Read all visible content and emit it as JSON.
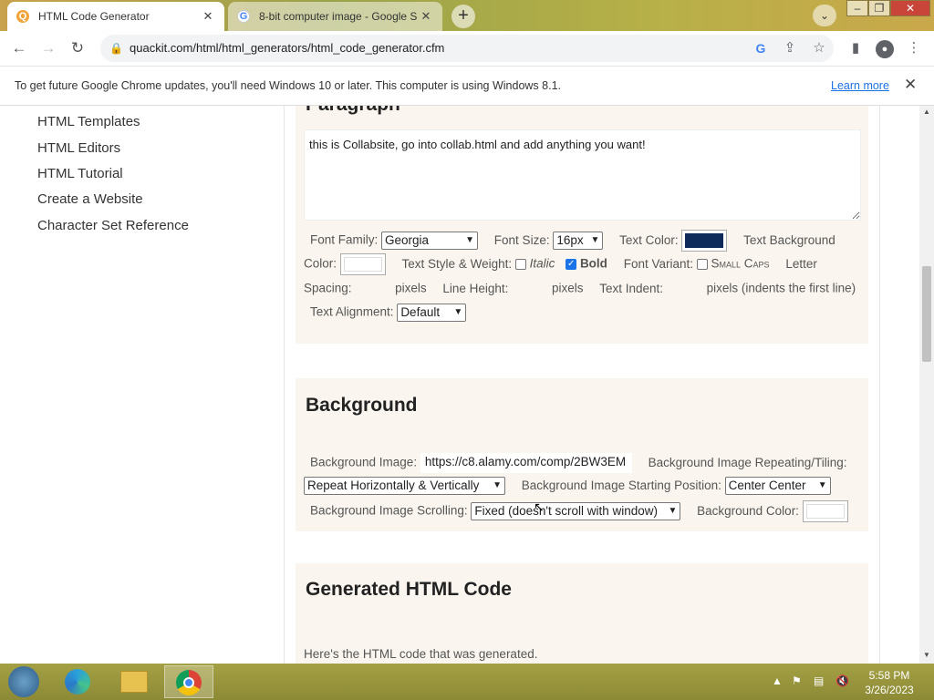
{
  "browser": {
    "tabs": [
      {
        "title": "HTML Code Generator",
        "active": true
      },
      {
        "title": "8-bit computer image - Google S",
        "active": false
      }
    ],
    "url": "quackit.com/html/html_generators/html_code_generator.cfm",
    "infobar": {
      "message": "To get future Google Chrome updates, you'll need Windows 10 or later. This computer is using Windows 8.1.",
      "link": "Learn more"
    }
  },
  "sidebar": {
    "links": [
      "HTML Templates",
      "HTML Editors",
      "HTML Tutorial",
      "Create a Website",
      "Character Set Reference"
    ]
  },
  "paragraph": {
    "title": "Paragraph",
    "text": "this is Collabsite, go into collab.html and add anything you want!",
    "font_family_label": "Font Family:",
    "font_family_value": "Georgia",
    "font_size_label": "Font Size:",
    "font_size_value": "16px",
    "text_color_label": "Text Color:",
    "text_color": "#0d2a5a",
    "text_background_label": "Text Background",
    "color_label": "Color:",
    "text_style_label": "Text Style & Weight:",
    "italic_label": "Italic",
    "bold_label": "Bold",
    "font_variant_label": "Font Variant:",
    "small_caps_label": "Small Caps",
    "letter_label": "Letter",
    "spacing_label": "Spacing:",
    "pixels": "pixels",
    "line_height_label": "Line Height:",
    "text_indent_label": "Text Indent:",
    "indent_note": "pixels (indents the first line)",
    "text_alignment_label": "Text Alignment:",
    "text_alignment_value": "Default"
  },
  "background": {
    "title": "Background",
    "image_label": "Background Image:",
    "image_value": "https://c8.alamy.com/comp/2BW3EM",
    "repeat_label": "Background Image Repeating/Tiling:",
    "repeat_value": "Repeat Horizontally & Vertically",
    "position_label": "Background Image Starting Position:",
    "position_value": "Center Center",
    "scrolling_label": "Background Image Scrolling:",
    "scrolling_value": "Fixed (doesn't scroll with window)",
    "color_label": "Background Color:"
  },
  "generated": {
    "title": "Generated HTML Code",
    "note": "Here's the HTML code that was generated."
  },
  "taskbar": {
    "time": "5:58 PM",
    "date": "3/26/2023"
  },
  "colors": {
    "accent": "#1a73e8",
    "panel_bg": "#faf6ef",
    "taskbar": "#9a9740"
  }
}
